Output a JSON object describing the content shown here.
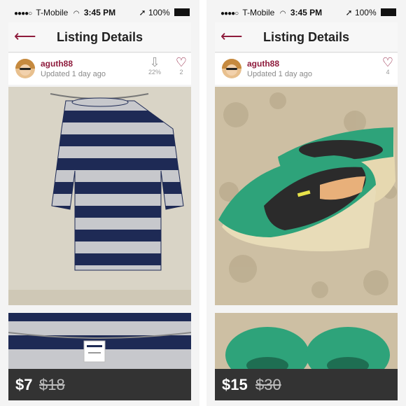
{
  "status": {
    "carrier": "T-Mobile",
    "time": "3:45 PM",
    "battery": "100%"
  },
  "nav": {
    "title": "Listing Details"
  },
  "listings": [
    {
      "username": "aguth88",
      "updated": "Updated 1 day ago",
      "price_drop_pct": "22%",
      "likes": "2",
      "price": "$7",
      "original_price": "$18",
      "item": "striped-shirt"
    },
    {
      "username": "aguth88",
      "updated": "Updated 1 day ago",
      "likes": "4",
      "price": "$15",
      "original_price": "$30",
      "item": "green-wedges"
    }
  ],
  "colors": {
    "accent": "#8e1b3c",
    "price_bar": "#222222",
    "navy": "#1e2a55",
    "gray_stripe": "#c7c8cc",
    "green_shoe": "#2ea37a"
  }
}
